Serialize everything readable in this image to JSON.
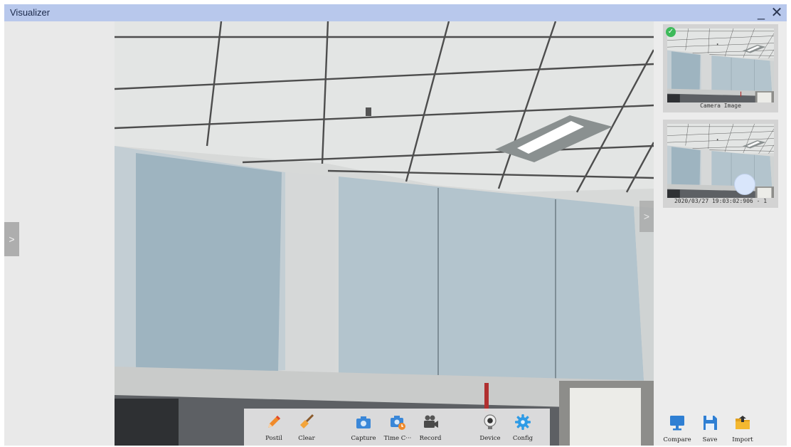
{
  "window": {
    "title": "Visualizer",
    "minimize_glyph": "_",
    "close_glyph": "✕"
  },
  "left_panel": {
    "toggle_glyph": ">"
  },
  "camera": {
    "side_toggle_glyph": ">"
  },
  "toolbar": {
    "items": [
      {
        "label": "Postil",
        "icon": "pencil-icon"
      },
      {
        "label": "Clear",
        "icon": "broom-icon"
      },
      {
        "label": "Capture",
        "icon": "camera-icon"
      },
      {
        "label": "Time C···",
        "icon": "timer-camera-icon"
      },
      {
        "label": "Record",
        "icon": "video-camera-icon"
      },
      {
        "label": "Device",
        "icon": "webcam-icon"
      },
      {
        "label": "Config",
        "icon": "gear-icon"
      }
    ]
  },
  "gallery": {
    "items": [
      {
        "caption": "Camera Image",
        "selected": true
      },
      {
        "caption": "2020/03/27 19:03:02:906 - 1",
        "selected": false
      }
    ]
  },
  "side_actions": [
    {
      "label": "Compare",
      "icon": "monitor-icon"
    },
    {
      "label": "Save",
      "icon": "floppy-icon"
    },
    {
      "label": "Import",
      "icon": "folder-import-icon"
    }
  ],
  "colors": {
    "titlebar": "#b8c8ec",
    "accent_blue": "#3a87d8",
    "check_green": "#3dba5a"
  }
}
